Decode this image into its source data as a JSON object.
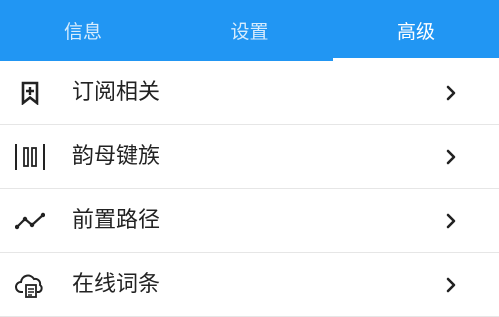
{
  "colors": {
    "accent": "#2196f3",
    "text": "#222222",
    "divider": "#e6e6e6"
  },
  "tabs": [
    {
      "label": "信息",
      "active": false
    },
    {
      "label": "设置",
      "active": false
    },
    {
      "label": "高级",
      "active": true
    }
  ],
  "items": [
    {
      "label": "订阅相关",
      "icon": "bookmark-plus-icon"
    },
    {
      "label": "韵母键族",
      "icon": "vertical-bars-icon"
    },
    {
      "label": "前置路径",
      "icon": "trend-path-icon"
    },
    {
      "label": "在线词条",
      "icon": "cloud-document-icon"
    }
  ]
}
